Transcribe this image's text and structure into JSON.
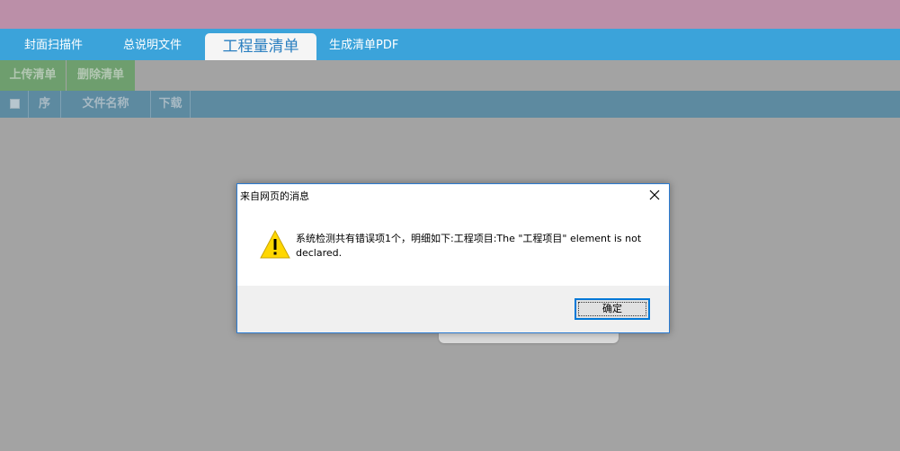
{
  "tabs": [
    {
      "label": "封面扫描件",
      "active": false
    },
    {
      "label": "总说明文件",
      "active": false
    },
    {
      "label": "工程量清单",
      "active": true
    },
    {
      "label": "生成清单PDF",
      "active": false
    }
  ],
  "toolbar": {
    "upload_label": "上传清单",
    "delete_label": "删除清单"
  },
  "table": {
    "columns": [
      "序",
      "文件名称",
      "下载"
    ]
  },
  "dialog": {
    "title": "来自网页的消息",
    "message": "系统检测共有错误项1个，明细如下:工程项目:The \"工程项目\" element is not declared.",
    "ok_label": "确定",
    "icon": "warning-icon"
  },
  "colors": {
    "tabbar": "#3ba3da",
    "top_band": "#bb8fa8",
    "overlay": "#a3a3a3",
    "accent_border": "#2b7cd3"
  }
}
